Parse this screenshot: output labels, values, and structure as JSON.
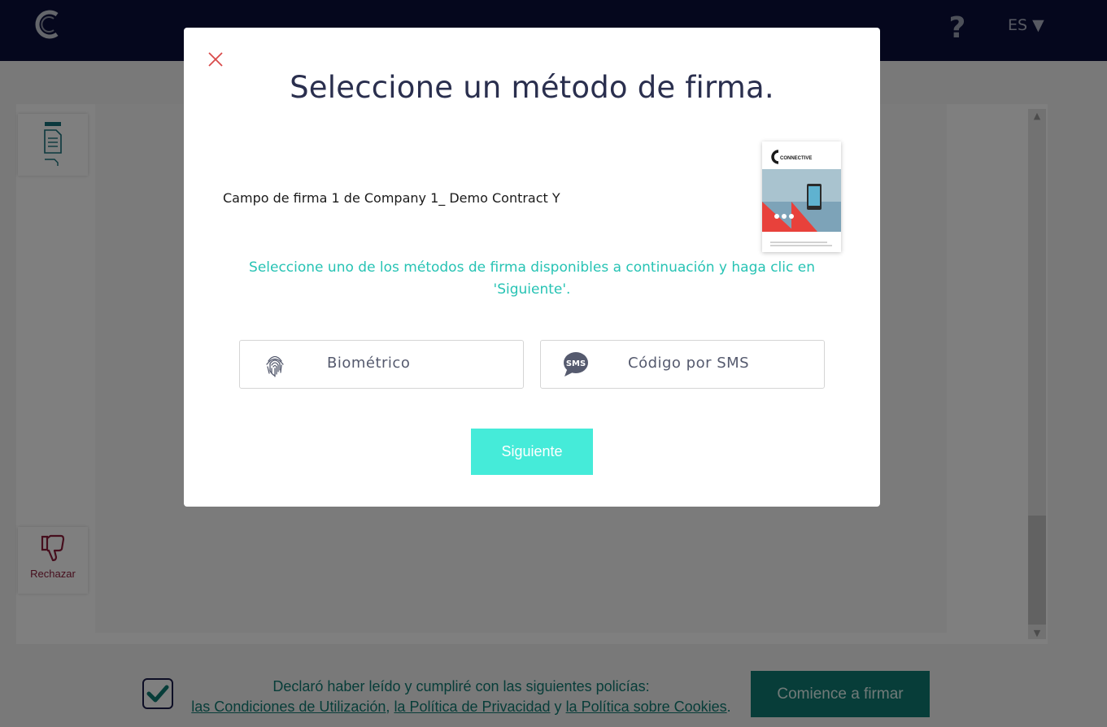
{
  "header": {
    "help_label": "?",
    "language": "ES ▼"
  },
  "sidebar": {
    "reject_label": "Rechazar"
  },
  "footer": {
    "consent_line1": "Declaró haber leído y cumpliré con las siguientes policías:",
    "terms_link": "las Condiciones de Utilización",
    "sep1": ", ",
    "privacy_link": "la Política de Privacidad",
    "sep2": " y ",
    "cookies_link": "la Política sobre Cookies",
    "end": ".",
    "start_button": "Comience a firmar"
  },
  "modal": {
    "title": "Seleccione un método de firma.",
    "field_name": "Campo de firma 1 de Company 1_ Demo Contract Y",
    "instructions": "Seleccione uno de los métodos de firma disponibles a continuación y haga clic en 'Siguiente'.",
    "methods": [
      {
        "icon": "fingerprint-icon",
        "label": "Biométrico"
      },
      {
        "icon": "sms-icon",
        "label": "Código por SMS",
        "icon_text": "SMS"
      }
    ],
    "next_button": "Siguiente"
  },
  "thumbnail": {
    "brand": "CONNECTIVE"
  },
  "colors": {
    "topbar": "#0a0e3a",
    "accent": "#45ebd9",
    "instruction_text": "#27c3b4",
    "footer_teal": "#0f7a72",
    "reject": "#8c1d3a"
  }
}
